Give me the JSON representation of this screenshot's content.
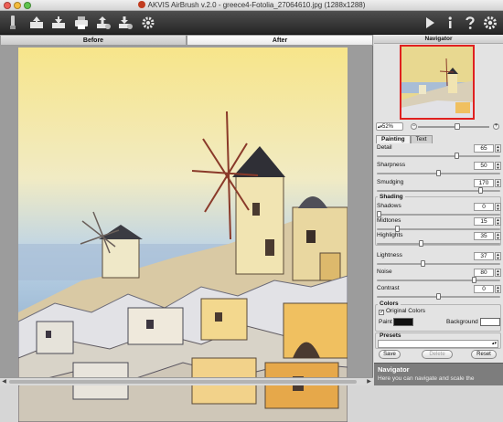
{
  "window": {
    "title": "AKVIS AirBrush v.2.0 - greece4-Fotolia_27064610.jpg (1288x1288)"
  },
  "toolbar": {
    "left_icons": [
      "brush-tool-icon",
      "open-icon",
      "save-icon",
      "print-icon",
      "upload-icon",
      "download-icon",
      "settings-gear-icon"
    ],
    "right_icons": [
      "run-icon",
      "info-icon",
      "help-icon",
      "preferences-icon"
    ]
  },
  "view_tabs": [
    {
      "label": "Before",
      "active": false
    },
    {
      "label": "After",
      "active": true
    }
  ],
  "navigator": {
    "title": "Navigator",
    "zoom": "52%",
    "zoom_fraction": 0.55
  },
  "panel_tabs": [
    {
      "label": "Painting",
      "active": true
    },
    {
      "label": "Text",
      "active": false
    }
  ],
  "params": {
    "detail": {
      "label": "Detail",
      "value": "65",
      "level": 0.65
    },
    "sharpness": {
      "label": "Sharpness",
      "value": "50",
      "level": 0.5
    },
    "smudging": {
      "label": "Smudging",
      "value": "170",
      "level": 0.85
    },
    "shading_title": "Shading",
    "shadows": {
      "label": "Shadows",
      "value": "0",
      "level": 0.0
    },
    "midtones": {
      "label": "Midtones",
      "value": "15",
      "level": 0.15
    },
    "highlights": {
      "label": "Highlights",
      "value": "35",
      "level": 0.35
    },
    "lightness": {
      "label": "Lightness",
      "value": "37",
      "level": 0.37
    },
    "noise": {
      "label": "Noise",
      "value": "80",
      "level": 0.8
    },
    "contrast": {
      "label": "Contrast",
      "value": "0",
      "level": 0.5
    }
  },
  "colors": {
    "title": "Colors",
    "original_colors_label": "Original Colors",
    "original_colors_checked": true,
    "paint_label": "Paint",
    "paint_color": "#111111",
    "background_label": "Background",
    "background_color": "#ffffff"
  },
  "presets": {
    "title": "Presets",
    "selected": ""
  },
  "buttons": {
    "save": "Save",
    "delete": "Delete",
    "reset": "Reset"
  },
  "help": {
    "title": "Navigator",
    "text": "Here you can navigate and scale the"
  }
}
